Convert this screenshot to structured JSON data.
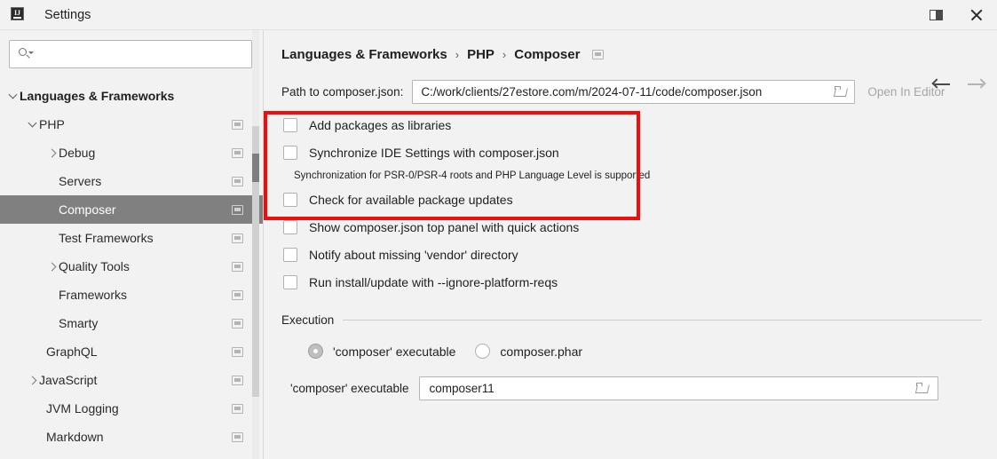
{
  "window": {
    "title": "Settings",
    "app_icon": "intellij-idea-icon",
    "layout_toggle_icon": "layout-toggle-icon",
    "close_icon": "close-icon"
  },
  "sidebar": {
    "search": {
      "value": "",
      "placeholder": "",
      "icon": "search-icon"
    },
    "clipped_row_text": "· · · ·",
    "items": [
      {
        "label": "Languages & Frameworks",
        "indent": 0,
        "arrow": "down",
        "bold": true,
        "selected": false,
        "mini_icon": false
      },
      {
        "label": "PHP",
        "indent": 1,
        "arrow": "down",
        "bold": false,
        "selected": false,
        "mini_icon": true
      },
      {
        "label": "Debug",
        "indent": 2,
        "arrow": "right",
        "bold": false,
        "selected": false,
        "mini_icon": true
      },
      {
        "label": "Servers",
        "indent": 2,
        "arrow": "none",
        "bold": false,
        "selected": false,
        "mini_icon": true
      },
      {
        "label": "Composer",
        "indent": 2,
        "arrow": "none",
        "bold": false,
        "selected": true,
        "mini_icon": true
      },
      {
        "label": "Test Frameworks",
        "indent": 2,
        "arrow": "none",
        "bold": false,
        "selected": false,
        "mini_icon": true
      },
      {
        "label": "Quality Tools",
        "indent": 2,
        "arrow": "right",
        "bold": false,
        "selected": false,
        "mini_icon": true
      },
      {
        "label": "Frameworks",
        "indent": 2,
        "arrow": "none",
        "bold": false,
        "selected": false,
        "mini_icon": true
      },
      {
        "label": "Smarty",
        "indent": 2,
        "arrow": "none",
        "bold": false,
        "selected": false,
        "mini_icon": true
      },
      {
        "label": "GraphQL",
        "indent": 1,
        "arrow": "none",
        "bold": false,
        "selected": false,
        "mini_icon": true
      },
      {
        "label": "JavaScript",
        "indent": 1,
        "arrow": "right",
        "bold": false,
        "selected": false,
        "mini_icon": true
      },
      {
        "label": "JVM Logging",
        "indent": 1,
        "arrow": "none",
        "bold": false,
        "selected": false,
        "mini_icon": true
      },
      {
        "label": "Markdown",
        "indent": 1,
        "arrow": "none",
        "bold": false,
        "selected": false,
        "mini_icon": true
      }
    ]
  },
  "content": {
    "breadcrumb": [
      "Languages & Frameworks",
      "PHP",
      "Composer"
    ],
    "breadcrumb_separator": "›",
    "breadcrumb_icon": "settings-sync-icon",
    "nav": {
      "back_icon": "arrow-left-icon",
      "forward_icon": "arrow-right-icon"
    },
    "path": {
      "label": "Path to composer.json:",
      "value": "C:/work/clients/27estore.com/m/2024-07-11/code/composer.json",
      "browse_icon": "folder-icon",
      "open_in_editor": "Open In Editor"
    },
    "options": [
      {
        "label": "Add packages as libraries",
        "checked": false
      },
      {
        "label": "Synchronize IDE Settings with composer.json",
        "checked": false
      },
      {
        "label": "Check for available package updates",
        "checked": false
      },
      {
        "label": "Show composer.json top panel with quick actions",
        "checked": false
      },
      {
        "label": "Notify about missing 'vendor' directory",
        "checked": false
      },
      {
        "label": "Run install/update with --ignore-platform-reqs",
        "checked": false
      }
    ],
    "sync_hint": "Synchronization for PSR-0/PSR-4 roots and PHP Language Level is supported",
    "highlight": {
      "color": "#f20d0d"
    },
    "execution": {
      "section_title": "Execution",
      "radios": [
        {
          "label": "'composer' executable",
          "selected": true
        },
        {
          "label": "composer.phar",
          "selected": false
        }
      ],
      "executable": {
        "label": "'composer' executable",
        "value": "composer11",
        "browse_icon": "folder-icon"
      }
    }
  }
}
